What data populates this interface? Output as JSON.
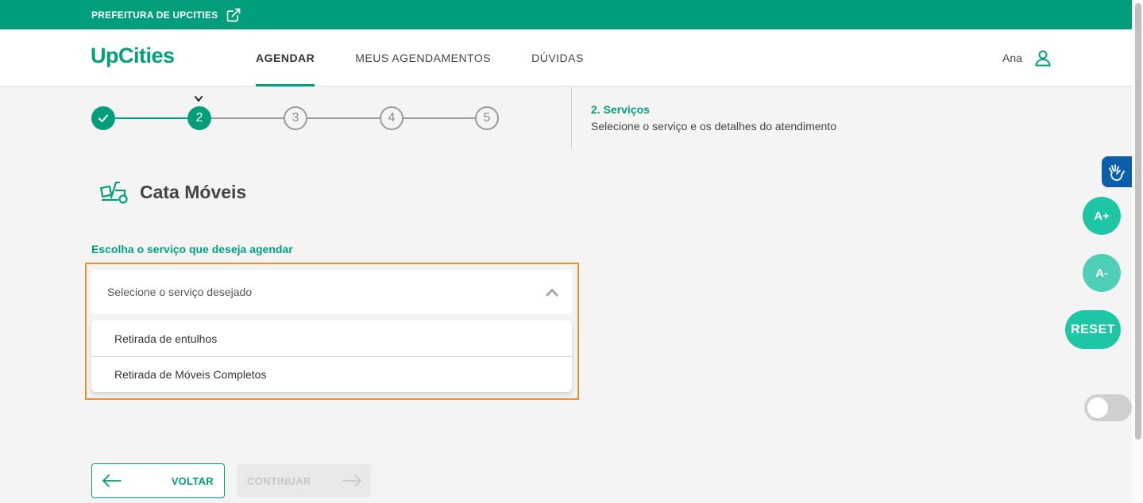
{
  "topbar": {
    "link_label": "PREFEITURA DE UPCITIES",
    "link_icon": "external-link-icon"
  },
  "header": {
    "logo": "UpCities",
    "nav": [
      {
        "label": "AGENDAR",
        "active": true
      },
      {
        "label": "MEUS AGENDAMENTOS",
        "active": false
      },
      {
        "label": "DÚVIDAS",
        "active": false
      }
    ],
    "user_name": "Ana",
    "user_icon": "user-icon"
  },
  "stepper": {
    "steps": [
      {
        "label": "",
        "state": "done"
      },
      {
        "label": "2",
        "state": "current"
      },
      {
        "label": "3",
        "state": "pending"
      },
      {
        "label": "4",
        "state": "pending"
      },
      {
        "label": "5",
        "state": "pending"
      }
    ],
    "title": "2. Serviços",
    "description": "Selecione o serviço e os detalhes do atendimento"
  },
  "service": {
    "icon": "furniture-truck-icon",
    "title": "Cata Móveis"
  },
  "form": {
    "label": "Escolha o serviço que deseja agendar",
    "select_placeholder": "Selecione o serviço desejado",
    "options": [
      "Retirada de entulhos",
      "Retirada de Móveis Completos"
    ]
  },
  "accessibility": {
    "sign_language_icon": "hand-sign-icon",
    "increase_font": "A+",
    "decrease_font": "A-",
    "reset": "RESET",
    "contrast_toggle_on": false
  },
  "actions": {
    "back": "VOLTAR",
    "continue": "CONTINUAR"
  },
  "colors": {
    "brand": "#019e7c",
    "accent_light": "#1ec6a6",
    "focus": "#f0902a",
    "vlibras": "#0b5ea8"
  }
}
